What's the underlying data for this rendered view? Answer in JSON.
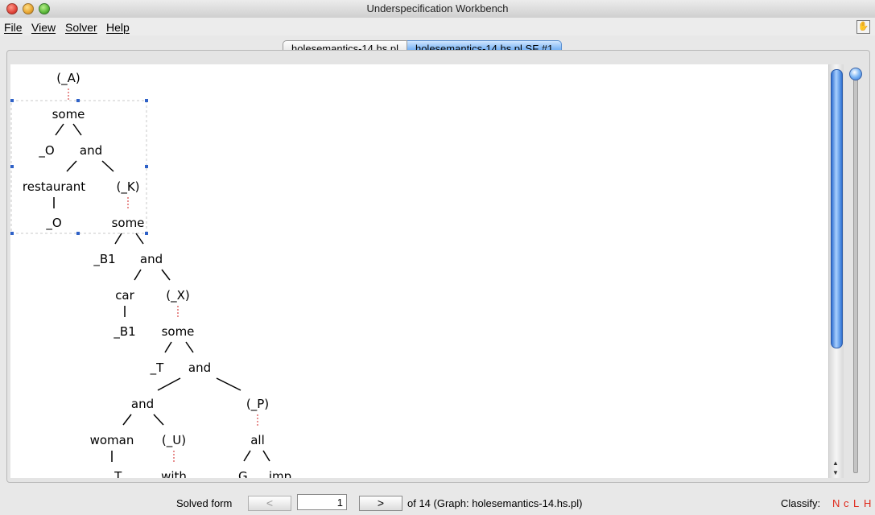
{
  "window": {
    "title": "Underspecification Workbench"
  },
  "menu": {
    "items": [
      "File",
      "View",
      "Solver",
      "Help"
    ]
  },
  "tabs": [
    {
      "label": "holesemantics-14.hs.pl"
    },
    {
      "label": "holesemantics-14.hs.pl  SF #1"
    }
  ],
  "tree": {
    "nodes": [
      "(_A)",
      "some",
      "_O",
      "and",
      "restaurant",
      "(_K)",
      "_O",
      "some",
      "_B1",
      "and",
      "car",
      "(_X)",
      "_B1",
      "some",
      "_T",
      "and",
      "and",
      "(_P)",
      "woman",
      "(_U)",
      "all",
      "_T",
      "with",
      "_G",
      "imp"
    ]
  },
  "status": {
    "solved_label": "Solved form",
    "prev_label": "<",
    "next_label": ">",
    "page_value": "1",
    "of_text": "of 14 (Graph: holesemantics-14.hs.pl)",
    "classify_label": "Classify:",
    "classify_flags": [
      "N",
      "c",
      "L",
      "H"
    ],
    "flag_color": "#e0281a"
  }
}
